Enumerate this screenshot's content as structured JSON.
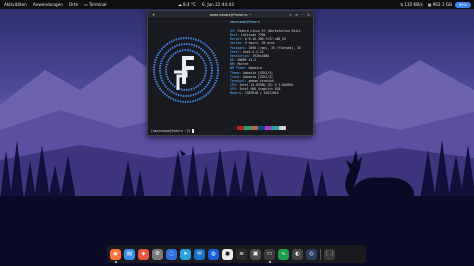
{
  "top_panel": {
    "activities": "Aktivitäten",
    "applications": "Anwendungen",
    "places": "Orte",
    "terminal_app": "Terminal",
    "weather": "8,4 °C",
    "datetime": "6. Jan 22:44:43",
    "network": "135 KB/s",
    "memory": "962.1 GB",
    "battery": "89%"
  },
  "terminal": {
    "title": "amarnaomi@fedora:~",
    "prompt_top": "amarnaomi@fedora",
    "info": [
      {
        "key": "OS:",
        "value": "Fedora Linux 37 (Workstation Editi"
      },
      {
        "key": "Host:",
        "value": "Latitude 7390"
      },
      {
        "key": "Kernel:",
        "value": "6.0.16-300.fc37.x86_64"
      },
      {
        "key": "Uptime:",
        "value": "5 hours, 36 mins"
      },
      {
        "key": "Packages:",
        "value": "2056 (rpm), 35 (flatpak), 26"
      },
      {
        "key": "Shell:",
        "value": "bash 5.2.15"
      },
      {
        "key": "Resolution:",
        "value": "1920x1080"
      },
      {
        "key": "DE:",
        "value": "GNOME 43.2"
      },
      {
        "key": "WM:",
        "value": "Mutter"
      },
      {
        "key": "WM Theme:",
        "value": "Adwaita"
      },
      {
        "key": "Theme:",
        "value": "Adwaita [GTK2/3]"
      },
      {
        "key": "Icons:",
        "value": "Adwaita [GTK2/3]"
      },
      {
        "key": "Terminal:",
        "value": "gnome-terminal"
      },
      {
        "key": "CPU:",
        "value": "Intel i5-8350U (8) @ 3.600GHz"
      },
      {
        "key": "GPU:",
        "value": "Intel UHD Graphics 620"
      },
      {
        "key": "Memory:",
        "value": "3387MiB / 15821MiB"
      }
    ],
    "prompt_bottom": "[amarnaomi@fedora ~]$ ",
    "palette": [
      "#1e1e1e",
      "#c01c28",
      "#26a269",
      "#a2734c",
      "#12488b",
      "#a347ba",
      "#2aa1b3",
      "#cfcfcf",
      "#5e5c64",
      "#f66151",
      "#33d17a",
      "#e9ad0c",
      "#2a7bde",
      "#c061cb",
      "#33c7de",
      "#ffffff"
    ]
  },
  "dock": {
    "apps": [
      {
        "name": "firefox-icon",
        "color": "#ff7139",
        "glyph": "◉",
        "running": true
      },
      {
        "name": "files-icon",
        "color": "#3d8ee6",
        "glyph": "▤",
        "running": false
      },
      {
        "name": "software-icon",
        "color": "#e6553d",
        "glyph": "◈",
        "running": false
      },
      {
        "name": "settings-icon",
        "color": "#7a7a7a",
        "glyph": "⚙",
        "running": false
      },
      {
        "name": "signal-icon",
        "color": "#2f6fde",
        "glyph": "◌",
        "running": false
      },
      {
        "name": "telegram-icon",
        "color": "#2aa1da",
        "glyph": "➤",
        "running": false
      },
      {
        "name": "thunderbird-icon",
        "color": "#1a73c8",
        "glyph": "✉",
        "running": false
      },
      {
        "name": "bitwarden-icon",
        "color": "#175ddc",
        "glyph": "◍",
        "running": false
      },
      {
        "name": "password-icon",
        "color": "#ececec",
        "glyph": "●",
        "running": false
      },
      {
        "name": "code-icon",
        "color": "#2b2b2b",
        "glyph": "≡",
        "running": false
      },
      {
        "name": "image-viewer-icon",
        "color": "#4a4a4a",
        "glyph": "▣",
        "running": false
      },
      {
        "name": "terminal-icon",
        "color": "#3a3a3a",
        "glyph": "▭",
        "running": true
      },
      {
        "name": "monitor-icon",
        "color": "#1f9e4a",
        "glyph": "∿",
        "running": false
      },
      {
        "name": "camera-icon",
        "color": "#444",
        "glyph": "◐",
        "running": false
      },
      {
        "name": "steam-icon",
        "color": "#2a3f5f",
        "glyph": "◎",
        "running": false
      },
      {
        "name": "app-grid-icon",
        "color": "#3a3a3a",
        "glyph": "⋮⋮",
        "running": false
      }
    ]
  }
}
